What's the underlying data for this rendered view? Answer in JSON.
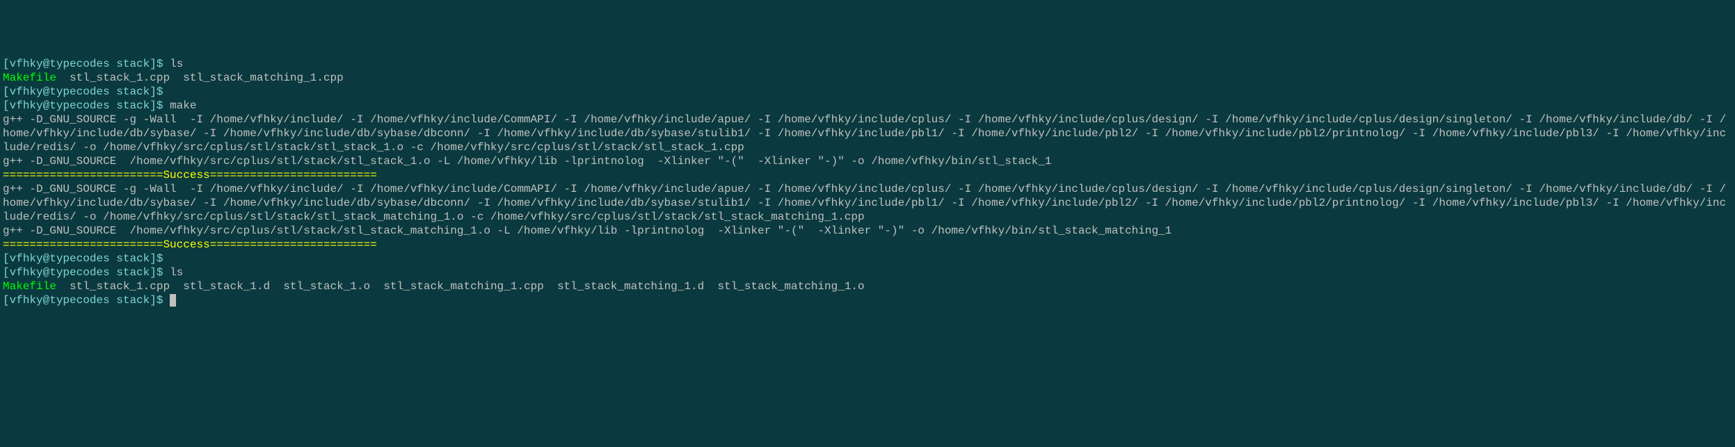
{
  "prompt": {
    "open": "[",
    "userhost": "vfhky@typecodes",
    "path": "stack",
    "close": "]$"
  },
  "commands": {
    "ls1": "ls",
    "make": "make",
    "ls2": "ls"
  },
  "ls_output_1": {
    "col1": "Makefile",
    "col2": "stl_stack_1.cpp",
    "col3": "stl_stack_matching_1.cpp"
  },
  "compile1_line": "g++ -D_GNU_SOURCE -g -Wall  -I /home/vfhky/include/ -I /home/vfhky/include/CommAPI/ -I /home/vfhky/include/apue/ -I /home/vfhky/include/cplus/ -I /home/vfhky/include/cplus/design/ -I /home/vfhky/include/cplus/design/singleton/ -I /home/vfhky/include/db/ -I /home/vfhky/include/db/sybase/ -I /home/vfhky/include/db/sybase/dbconn/ -I /home/vfhky/include/db/sybase/stulib1/ -I /home/vfhky/include/pbl1/ -I /home/vfhky/include/pbl2/ -I /home/vfhky/include/pbl2/printnolog/ -I /home/vfhky/include/pbl3/ -I /home/vfhky/include/redis/ -o /home/vfhky/src/cplus/stl/stack/stl_stack_1.o -c /home/vfhky/src/cplus/stl/stack/stl_stack_1.cpp",
  "link1_line": "g++ -D_GNU_SOURCE  /home/vfhky/src/cplus/stl/stack/stl_stack_1.o -L /home/vfhky/lib -lprintnolog  -Xlinker \"-(\"  -Xlinker \"-)\" -o /home/vfhky/bin/stl_stack_1",
  "success_line": "========================Success=========================",
  "compile2_line": "g++ -D_GNU_SOURCE -g -Wall  -I /home/vfhky/include/ -I /home/vfhky/include/CommAPI/ -I /home/vfhky/include/apue/ -I /home/vfhky/include/cplus/ -I /home/vfhky/include/cplus/design/ -I /home/vfhky/include/cplus/design/singleton/ -I /home/vfhky/include/db/ -I /home/vfhky/include/db/sybase/ -I /home/vfhky/include/db/sybase/dbconn/ -I /home/vfhky/include/db/sybase/stulib1/ -I /home/vfhky/include/pbl1/ -I /home/vfhky/include/pbl2/ -I /home/vfhky/include/pbl2/printnolog/ -I /home/vfhky/include/pbl3/ -I /home/vfhky/include/redis/ -o /home/vfhky/src/cplus/stl/stack/stl_stack_matching_1.o -c /home/vfhky/src/cplus/stl/stack/stl_stack_matching_1.cpp",
  "link2_line": "g++ -D_GNU_SOURCE  /home/vfhky/src/cplus/stl/stack/stl_stack_matching_1.o -L /home/vfhky/lib -lprintnolog  -Xlinker \"-(\"  -Xlinker \"-)\" -o /home/vfhky/bin/stl_stack_matching_1",
  "ls_output_2": {
    "col1": "Makefile",
    "col2": "stl_stack_1.cpp",
    "col3": "stl_stack_1.d",
    "col4": "stl_stack_1.o",
    "col5": "stl_stack_matching_1.cpp",
    "col6": "stl_stack_matching_1.d",
    "col7": "stl_stack_matching_1.o"
  }
}
